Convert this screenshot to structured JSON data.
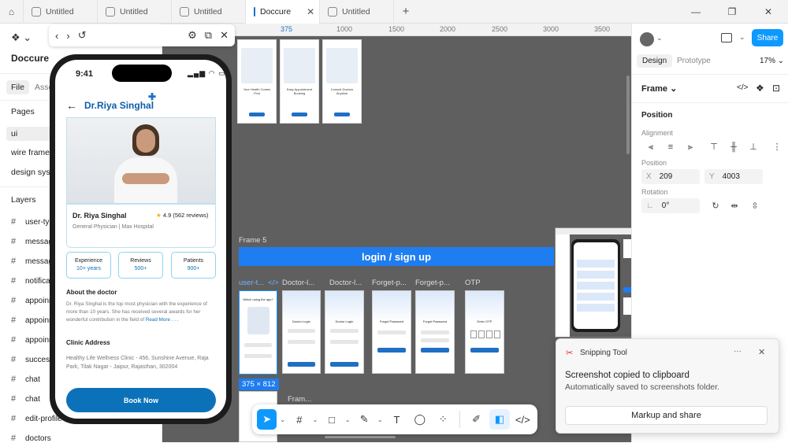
{
  "tabs": [
    {
      "label": "Untitled",
      "active": false
    },
    {
      "label": "Untitled",
      "active": false
    },
    {
      "label": "Untitled",
      "active": false
    },
    {
      "label": "Doccure",
      "active": true
    },
    {
      "label": "Untitled",
      "active": false
    }
  ],
  "tab_add": "+",
  "window_controls": {
    "minimize": "—",
    "maximize": "❐",
    "close": "✕"
  },
  "left": {
    "project": "Doccure",
    "tabs": [
      "File",
      "Asse"
    ],
    "pages_title": "Pages",
    "pages": [
      "ui",
      "wire frame",
      "design syste"
    ],
    "layers_title": "Layers",
    "layers": [
      "user-ty",
      "messag",
      "messag",
      "notifica",
      "appoinr",
      "appoinr",
      "appoinr",
      "success",
      "chat",
      "chat",
      "edit-profile",
      "doctors"
    ]
  },
  "preview_bar": {
    "back": "‹",
    "forward": "›",
    "refresh": "↺",
    "settings": "⚙",
    "open": "⧉",
    "close": "✕"
  },
  "phone": {
    "time": "9:41",
    "title": "Dr.Riya Singhal",
    "doctor_name": "Dr. Riya Singhal",
    "rating": "4.9 (562 reviews)",
    "specialty": "General Physician | Max Hospital",
    "stats": [
      {
        "label": "Experience",
        "value": "10+ years"
      },
      {
        "label": "Reviews",
        "value": "500+"
      },
      {
        "label": "Patients",
        "value": "900+"
      }
    ],
    "about_title": "About the doctor",
    "about_text": "Dr. Riya Singhal is the top most physician with the experience of more than 10 years. She has received several awards for her wonderful contribution in the field of ",
    "read_more": "Read More . . .",
    "clinic_title": "Clinic Address",
    "clinic_text": "Healthy Life Wellness Clinic - 456, Sunshine Avenue, Raja Park, Tilak Nagar - Jaipur, Rajasthan, 302004",
    "book_button": "Book Now",
    "colors": {
      "primary": "#0b72b9",
      "accent": "#1f6fc4"
    }
  },
  "canvas": {
    "ruler": [
      "375",
      "1000",
      "1500",
      "2000",
      "2500",
      "3000",
      "3500"
    ],
    "onboarding": [
      {
        "title": "Your Health Comes First",
        "btn": "Next"
      },
      {
        "title": "Easy Appointment Booking",
        "btn": "Next"
      },
      {
        "title": "Consult Doctors Anytime",
        "btn": "Get Started"
      }
    ],
    "frame5_label": "Frame 5",
    "banner": "login / sign up",
    "frame_labels": [
      "user-t...",
      "Doctor-l...",
      "Doctor-l...",
      "Forget-p...",
      "Forget-p...",
      "OTP"
    ],
    "frame_titles": [
      "Which using the app?",
      "Doctor Login",
      "Doctor Login",
      "Forgot Password",
      "Forgot Password",
      "Enter OTP"
    ],
    "code_icon": "</>",
    "size_badge": "375 × 812",
    "frame_label_bottom": "Fram..."
  },
  "toolbar": {
    "move": "➤",
    "frame": "#",
    "shape": "□",
    "pen": "✎",
    "text": "T",
    "comment": "◯",
    "actions": "⁘",
    "draw": "✐",
    "dev": "</>"
  },
  "right": {
    "share": "Share",
    "tabs": [
      "Design",
      "Prototype"
    ],
    "zoom": "17%",
    "frame": "Frame",
    "position_section": "Position",
    "alignment": "Alignment",
    "position_label": "Position",
    "x_label": "X",
    "x": "209",
    "y_label": "Y",
    "y": "4003",
    "rotation_label": "Rotation",
    "rotation": "0°"
  },
  "snip": {
    "app": "Snipping Tool",
    "more": "···",
    "close": "✕",
    "title": "Screenshot copied to clipboard",
    "subtitle": "Automatically saved to screenshots folder.",
    "button": "Markup and share"
  }
}
